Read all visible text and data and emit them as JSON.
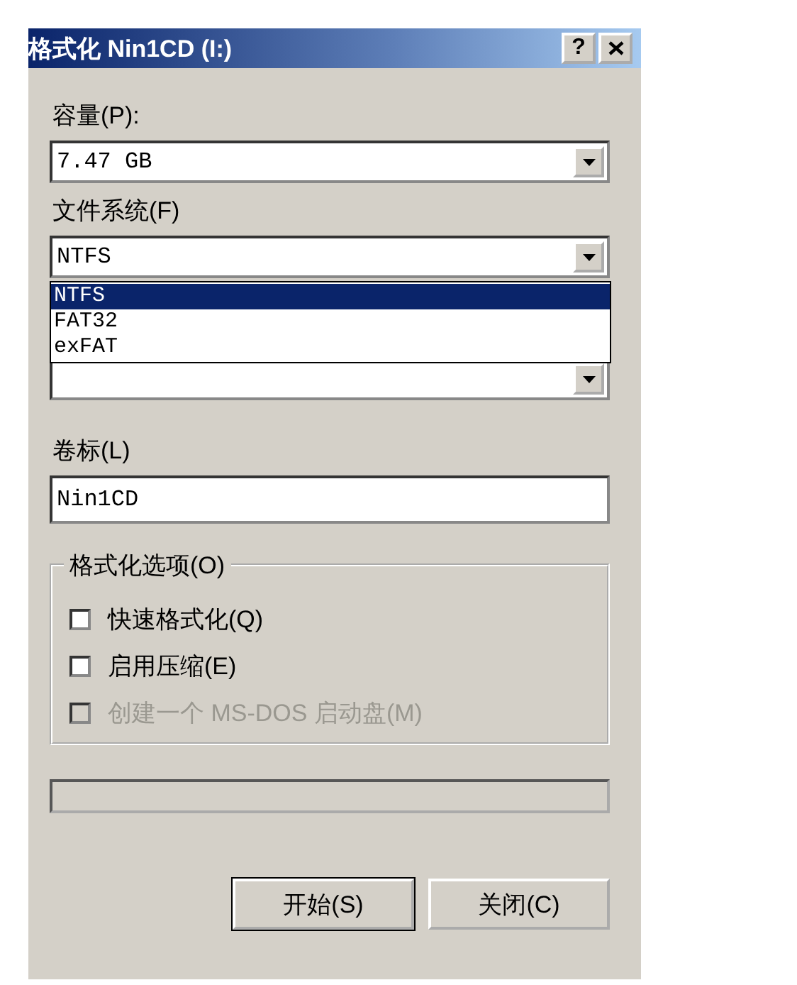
{
  "window": {
    "title": "格式化 Nin1CD (I:)",
    "controls": [
      {
        "kind": "help",
        "label": "?"
      },
      {
        "kind": "close"
      }
    ]
  },
  "capacity": {
    "label": "容量(P):",
    "value": "7.47 GB"
  },
  "file_system": {
    "label": "文件系统(F)",
    "value": "NTFS",
    "expanded": true,
    "options": [
      {
        "label": "NTFS",
        "selected": true
      },
      {
        "label": "FAT32",
        "selected": false
      },
      {
        "label": "exFAT",
        "selected": false
      }
    ]
  },
  "volume_label": {
    "label": "卷标(L)",
    "value": "Nin1CD"
  },
  "format_options": {
    "title": "格式化选项(O)",
    "options": [
      {
        "label": "快速格式化(Q)",
        "checked": false,
        "disabled": false
      },
      {
        "label": "启用压缩(E)",
        "checked": false,
        "disabled": false
      },
      {
        "label": "创建一个 MS-DOS 启动盘(M)",
        "checked": false,
        "disabled": true
      }
    ]
  },
  "progress": {
    "level": 0
  },
  "buttons": [
    {
      "label": "开始(S)",
      "default": true
    },
    {
      "label": "关闭(C)",
      "default": false
    }
  ]
}
